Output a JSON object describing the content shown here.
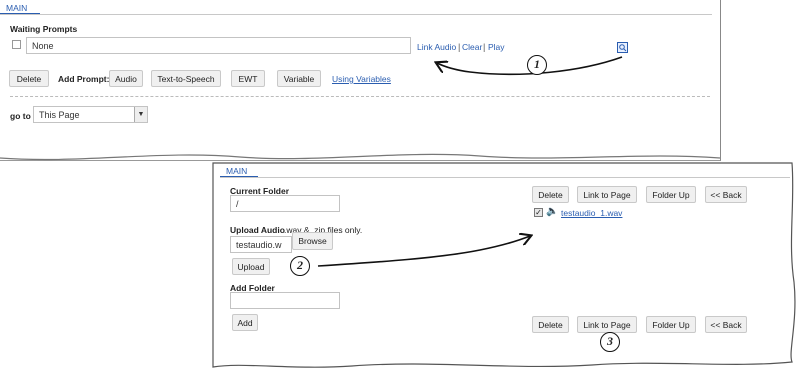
{
  "top_panel": {
    "tab_label": "MAIN",
    "waiting_prompts_label": "Waiting Prompts",
    "prompt_value": "None",
    "link_audio": "Link Audio",
    "separator": "|",
    "clear": "Clear",
    "play": "Play",
    "delete_button": "Delete",
    "add_prompt_label": "Add Prompt:",
    "audio_button": "Audio",
    "tts_button": "Text-to-Speech",
    "ewt_button": "EWT",
    "variable_button": "Variable",
    "using_variables_link": "Using Variables",
    "goto_label": "go to",
    "goto_value": "This Page"
  },
  "bottom_panel": {
    "tab_label": "MAIN",
    "current_folder_label": "Current Folder",
    "current_folder_value": "/",
    "upload_audio_label": "Upload Audio",
    "upload_audio_note": ".wav & .zip files only.",
    "file_value": "testaudio.w",
    "browse_button": "Browse",
    "upload_button": "Upload",
    "add_folder_label": "Add Folder",
    "add_folder_value": "",
    "add_button": "Add",
    "toolbar": {
      "delete": "Delete",
      "link_to_page": "Link to Page",
      "folder_up": "Folder Up",
      "back": "<< Back"
    },
    "file_item": {
      "name": "testaudio_1.wav",
      "checked": true
    }
  },
  "annotations": [
    "1",
    "2",
    "3"
  ],
  "colors": {
    "link": "#2a5db0",
    "button_bg": "#f0f0f0"
  }
}
